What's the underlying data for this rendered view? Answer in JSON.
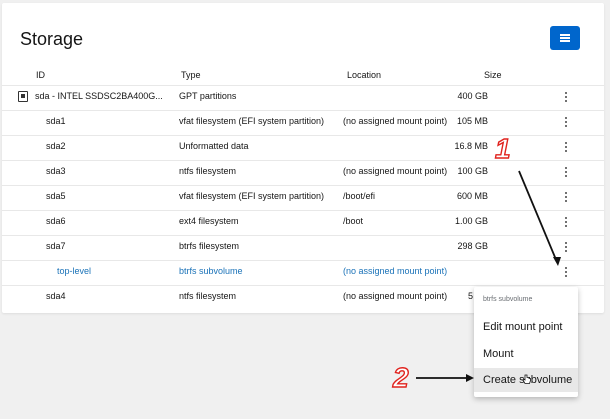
{
  "card": {
    "title": "Storage"
  },
  "table": {
    "headers": [
      "ID",
      "Type",
      "Location",
      "Size"
    ],
    "rows": [
      {
        "id": "sda - INTEL SSDSC2BA400G...",
        "type": "GPT partitions",
        "location": "",
        "size": "400 GB"
      },
      {
        "id": "sda1",
        "type": "vfat filesystem (EFI system partition)",
        "location": "(no assigned mount point)",
        "size": "105 MB"
      },
      {
        "id": "sda2",
        "type": "Unformatted data",
        "location": "",
        "size": "16.8 MB"
      },
      {
        "id": "sda3",
        "type": "ntfs filesystem",
        "location": "(no assigned mount point)",
        "size": "100 GB"
      },
      {
        "id": "sda5",
        "type": "vfat filesystem (EFI system partition)",
        "location": "/boot/efi",
        "size": "600 MB"
      },
      {
        "id": "sda6",
        "type": "ext4 filesystem",
        "location": "/boot",
        "size": "1.00 GB"
      },
      {
        "id": "sda7",
        "type": "btrfs filesystem",
        "location": "",
        "size": "298 GB"
      },
      {
        "id": "top-level",
        "type": "btrfs subvolume",
        "location": "(no assigned mount point)",
        "size": ""
      },
      {
        "id": "sda4",
        "type": "ntfs filesystem",
        "location": "(no assigned mount point)",
        "size": "5"
      }
    ]
  },
  "dropdown": {
    "header": "btrfs subvolume",
    "items": [
      "Edit mount point",
      "Mount",
      "Create subvolume"
    ]
  },
  "annotations": {
    "one": "1",
    "two": "2"
  },
  "icons": {
    "menu": "hamburger-icon",
    "disk": "disk-icon",
    "kebab": "kebab-icon",
    "cursor": "hand-cursor-icon"
  },
  "colors": {
    "primary": "#0066cc",
    "link": "#1a72b8",
    "annotation": "#e0231e"
  }
}
